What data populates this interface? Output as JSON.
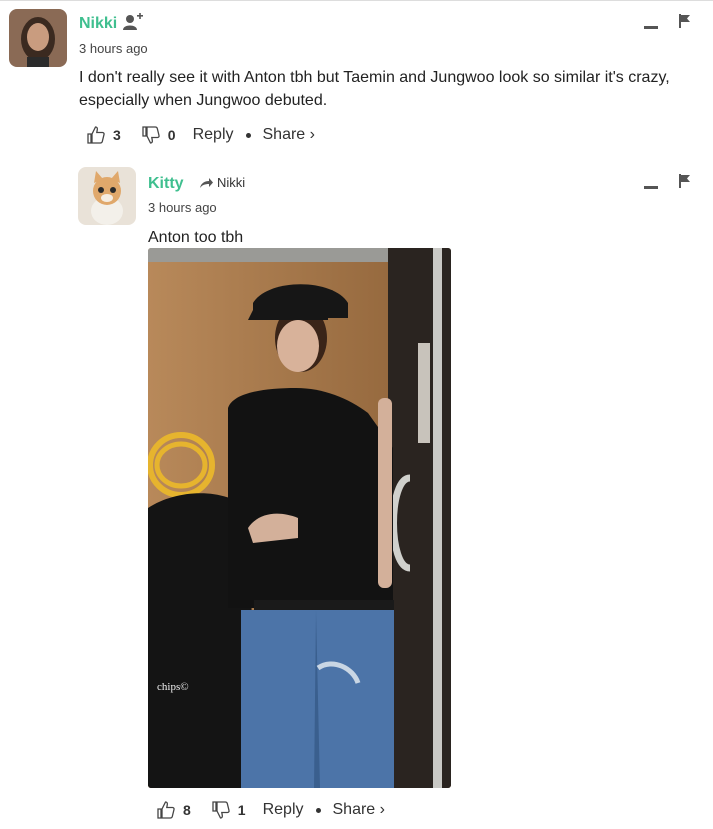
{
  "comments": [
    {
      "username": "Nikki",
      "timestamp": "3 hours ago",
      "text_lines": [
        "I don't really see it with Anton tbh but Taemin and Jungwoo look so similar it's crazy,",
        "especially when Jungwoo debuted."
      ],
      "likes": "3",
      "dislikes": "0",
      "reply_label": "Reply",
      "share_label": "Share ›"
    },
    {
      "username": "Kitty",
      "reply_to": "Nikki",
      "timestamp": "3 hours ago",
      "text": "Anton too tbh",
      "image_watermark": "chips©",
      "likes": "8",
      "dislikes": "1",
      "reply_label": "Reply",
      "share_label": "Share ›"
    }
  ],
  "colors": {
    "username": "#3fbf8f",
    "text": "#222222",
    "icon": "#444444"
  }
}
